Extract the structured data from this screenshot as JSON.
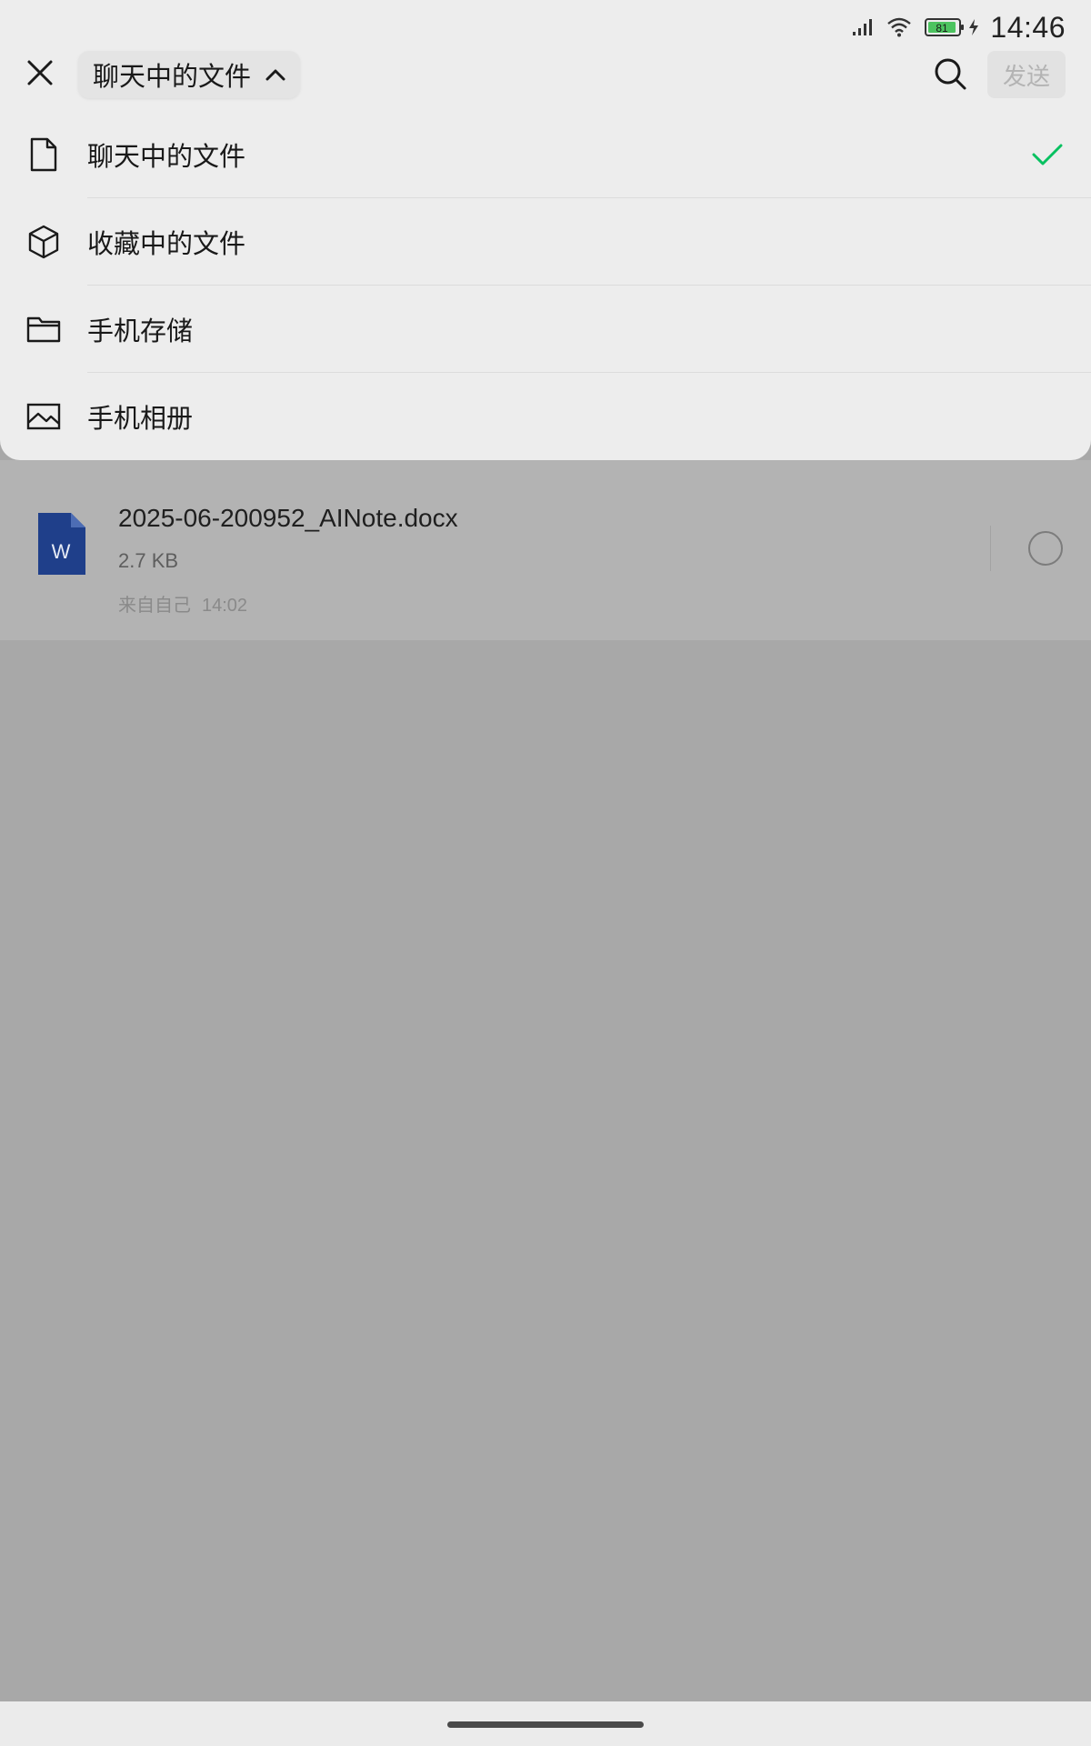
{
  "status_bar": {
    "time": "14:46",
    "battery": "81",
    "icons": [
      "signal-icon",
      "wifi-icon",
      "battery-icon",
      "charging-icon"
    ]
  },
  "header": {
    "close_icon": "close-icon",
    "source_label": "聊天中的文件",
    "dropdown_icon": "chevron-up-icon",
    "search_icon": "search-icon",
    "send_label": "发送"
  },
  "menu": {
    "items": [
      {
        "label": "聊天中的文件",
        "icon": "file-icon",
        "selected": true
      },
      {
        "label": "收藏中的文件",
        "icon": "cube-icon",
        "selected": false
      },
      {
        "label": "手机存储",
        "icon": "folder-icon",
        "selected": false
      },
      {
        "label": "手机相册",
        "icon": "image-icon",
        "selected": false
      }
    ],
    "check_color": "#07c160"
  },
  "files": [
    {
      "name": "2025-06-200952_AINote.docx",
      "size": "2.7 KB",
      "from": "来自自己",
      "time": "14:02",
      "icon": "word-doc-icon",
      "icon_letter": "W"
    }
  ],
  "colors": {
    "overlay_background": "#a8a8a8",
    "sheet_background": "#ededed",
    "word_blue": "#1f3f8a",
    "accent_green": "#07c160"
  }
}
